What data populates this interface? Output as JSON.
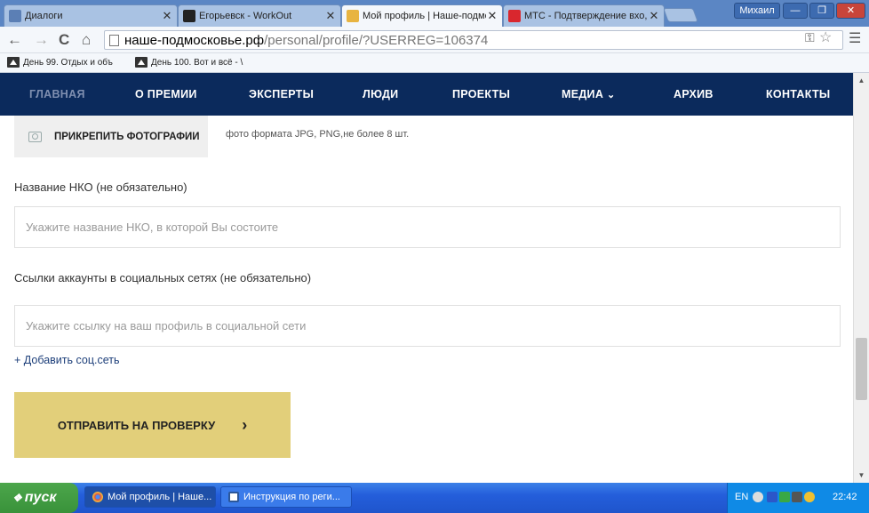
{
  "browser": {
    "tabs": [
      {
        "title": "Диалоги",
        "active": false
      },
      {
        "title": "Егорьевск - WorkOut",
        "active": false
      },
      {
        "title": "Мой профиль | Наше-подмо",
        "active": true
      },
      {
        "title": "МТС - Подтверждение вхо,",
        "active": false
      }
    ],
    "user_label": "Михаил",
    "url_host": "наше-подмосковье.рф",
    "url_path": "/personal/profile/?USERREG=106374",
    "bookmarks": [
      "День 99. Отдых и объ",
      "День 100. Вот и всё - \\"
    ]
  },
  "site_nav": {
    "items": [
      "ГЛАВНАЯ",
      "О ПРЕМИИ",
      "ЭКСПЕРТЫ",
      "ЛЮДИ",
      "ПРОЕКТЫ",
      "МЕДИА",
      "АРХИВ",
      "КОНТАКТЫ"
    ]
  },
  "form": {
    "attach_label": "ПРИКРЕПИТЬ ФОТОГРАФИИ",
    "attach_hint": "фото формата JPG, PNG,не более 8 шт.",
    "nko_label": "Название НКО (не обязательно)",
    "nko_placeholder": "Укажите название НКО, в которой Вы состоите",
    "social_label": "Ссылки аккаунты в социальных сетях (не обязательно)",
    "social_placeholder": "Укажите ссылку на ваш профиль в социальной сети",
    "add_social": "+ Добавить соц.сеть",
    "submit_label": "ОТПРАВИТЬ НА ПРОВЕРКУ"
  },
  "taskbar": {
    "start_label": "пуск",
    "windows": [
      "Мой профиль | Наше...",
      "Инструкция по реги..."
    ],
    "language": "EN",
    "clock": "22:42"
  },
  "colors": {
    "nav_bg": "#0b2a5c",
    "submit_bg": "#e2cf7a",
    "link": "#1d3f7a"
  }
}
